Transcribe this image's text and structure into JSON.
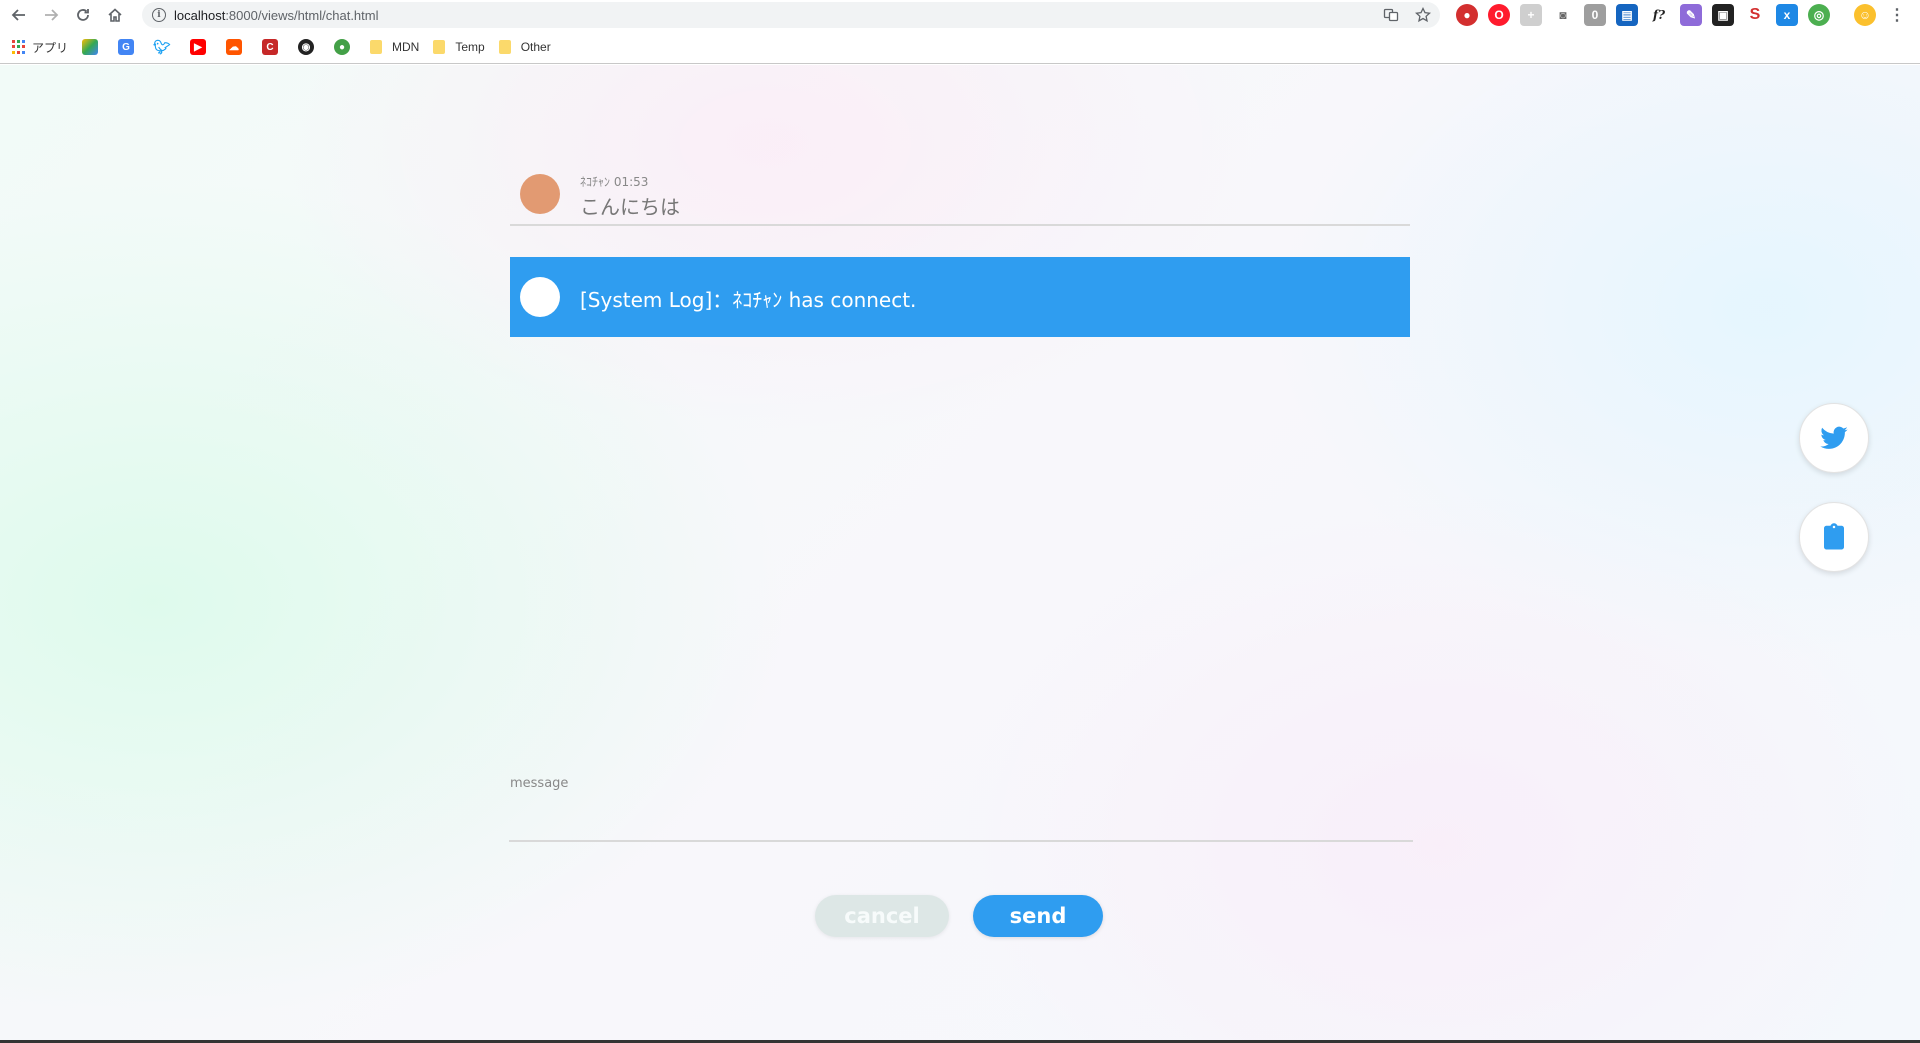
{
  "browser": {
    "url_host": "localhost",
    "url_path": ":8000/views/html/chat.html",
    "bookmarks": {
      "apps_label": "アプリ",
      "folders": [
        "MDN",
        "Temp",
        "Other"
      ]
    },
    "extensions": [
      "lastpass",
      "opera",
      "add",
      "camera",
      "number",
      "book",
      "fx",
      "pen",
      "ghost",
      "s",
      "translate",
      "green",
      "profile",
      "menu"
    ]
  },
  "chat": {
    "messages": [
      {
        "author": "ﾈｺﾁｬﾝ",
        "time": "01:53",
        "text": "こんにちは",
        "avatar_color": "#e29a72"
      }
    ],
    "system_log": {
      "text": "[System Log]：ﾈｺﾁｬﾝ has connect."
    }
  },
  "composer": {
    "label": "message",
    "value": "",
    "cancel_label": "cancel",
    "send_label": "send"
  },
  "colors": {
    "accent": "#2f9df0",
    "cancel_bg": "#dde7e6"
  }
}
